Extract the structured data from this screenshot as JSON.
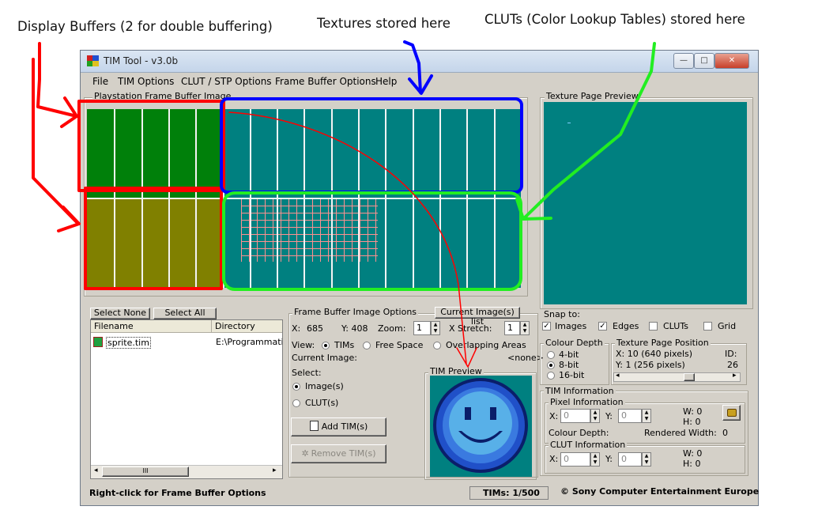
{
  "annotations": {
    "display_buffers": "Display Buffers (2 for double buffering)",
    "textures": "Textures stored here",
    "cluts": "CLUTs (Color Lookup Tables) stored here"
  },
  "window": {
    "title": "TIM Tool - v3.0b",
    "controls": {
      "minimize": "—",
      "maximize": "□",
      "close": "✕"
    }
  },
  "menu": [
    "File",
    "TIM Options",
    "CLUT / STP Options",
    "Frame Buffer Options",
    "Help"
  ],
  "frame_buffer": {
    "label": "Playstation Frame Buffer Image"
  },
  "texture_preview": {
    "label": "Texture Page Preview"
  },
  "file_list": {
    "select_none": "Select None",
    "select_all": "Select All",
    "columns": [
      "Filename",
      "Directory"
    ],
    "rows": [
      {
        "filename": "sprite.tim",
        "directory": "E:\\Programmation"
      }
    ],
    "scroll_thumb": "III"
  },
  "fb_options": {
    "label": "Frame Buffer Image Options",
    "current_list_button": "Current Image(s) list",
    "x_label": "X:",
    "x_value": "685",
    "y_label": "Y: 408",
    "zoom_label": "Zoom:",
    "zoom_value": "1",
    "stretch_label": "X Stretch:",
    "stretch_value": "1",
    "view_label": "View:",
    "view_options": [
      "TIMs",
      "Free Space",
      "Overlapping Areas"
    ],
    "view_selected": 0,
    "current_image_label": "Current Image:",
    "current_image_value": "<none>",
    "select_label": "Select:",
    "select_options": [
      "Image(s)",
      "CLUT(s)"
    ],
    "select_selected": 0,
    "add_button": "Add TIM(s)",
    "remove_button": "Remove TIM(s)"
  },
  "tim_preview": {
    "label": "TIM Preview"
  },
  "snap": {
    "label": "Snap to:",
    "options": [
      {
        "label": "Images",
        "checked": true
      },
      {
        "label": "Edges",
        "checked": true
      },
      {
        "label": "CLUTs",
        "checked": false
      },
      {
        "label": "Grid",
        "checked": false
      }
    ]
  },
  "colour_depth": {
    "label": "Colour Depth",
    "options": [
      "4-bit",
      "8-bit",
      "16-bit"
    ],
    "selected": 1
  },
  "texture_page_position": {
    "label": "Texture Page Position",
    "x": "X: 10 (640 pixels)",
    "y": "Y: 1 (256 pixels)",
    "id_label": "ID:",
    "id_value": "26"
  },
  "tim_info": {
    "label": "TIM Information",
    "pixel_label": "Pixel Information",
    "x_label": "X:",
    "x_value": "0",
    "y_label": "Y:",
    "y_value": "0",
    "w": "W: 0",
    "h": "H: 0",
    "colour_depth_label": "Colour Depth:",
    "rendered_width_label": "Rendered Width:",
    "rendered_width_value": "0",
    "clut_label": "CLUT Information",
    "clut_x_value": "0",
    "clut_y_value": "0",
    "clut_w": "W: 0",
    "clut_h": "H: 0"
  },
  "status": {
    "hint": "Right-click for Frame Buffer Options",
    "tims": "TIMs: 1/500",
    "copyright": "© Sony Computer Entertainment Europe"
  },
  "colors": {
    "frame_buffer": "#008080",
    "display_buffer_top": "#00800a",
    "display_buffer_bottom": "#808000",
    "annotation_red": "#ff0000",
    "annotation_blue": "#0000ff",
    "annotation_green": "#22ee22"
  }
}
